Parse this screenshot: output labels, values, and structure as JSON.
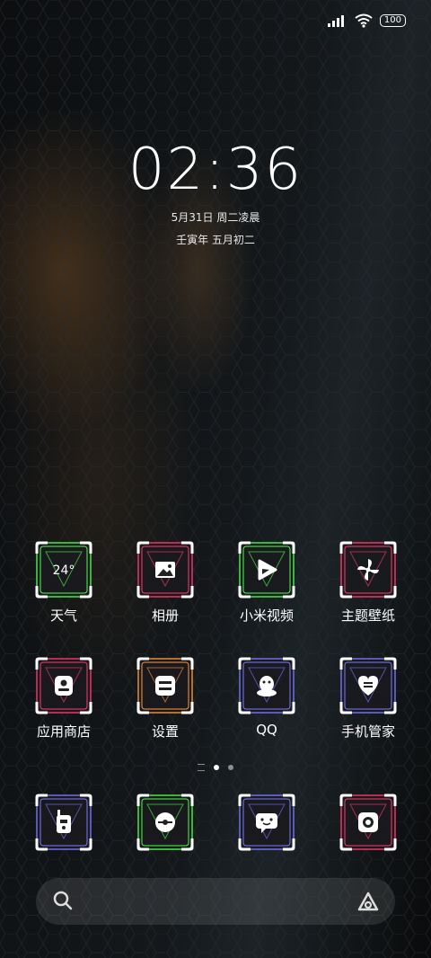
{
  "status": {
    "battery": "100"
  },
  "clock": {
    "time": "02:36",
    "date": "5月31日 周二凌晨",
    "lunar": "壬寅年 五月初二"
  },
  "apps_row1": [
    {
      "label": "天气",
      "color": "#4cff4c",
      "icon": "weather",
      "temp": "24°"
    },
    {
      "label": "相册",
      "color": "#ff3c6e",
      "icon": "gallery"
    },
    {
      "label": "小米视频",
      "color": "#4cff4c",
      "icon": "video"
    },
    {
      "label": "主题壁纸",
      "color": "#ff3c6e",
      "icon": "themes"
    }
  ],
  "apps_row2": [
    {
      "label": "应用商店",
      "color": "#ff3c6e",
      "icon": "appstore"
    },
    {
      "label": "设置",
      "color": "#ff9a3c",
      "icon": "settings"
    },
    {
      "label": "QQ",
      "color": "#7a7aff",
      "icon": "qq"
    },
    {
      "label": "手机管家",
      "color": "#7a7aff",
      "icon": "security"
    }
  ],
  "dock": [
    {
      "color": "#7a7aff",
      "icon": "walkie-talkie"
    },
    {
      "color": "#4cff4c",
      "icon": "browser"
    },
    {
      "color": "#7a7aff",
      "icon": "messages"
    },
    {
      "color": "#ff3c6e",
      "icon": "camera"
    }
  ],
  "pages": {
    "count": 2,
    "active": 1
  }
}
